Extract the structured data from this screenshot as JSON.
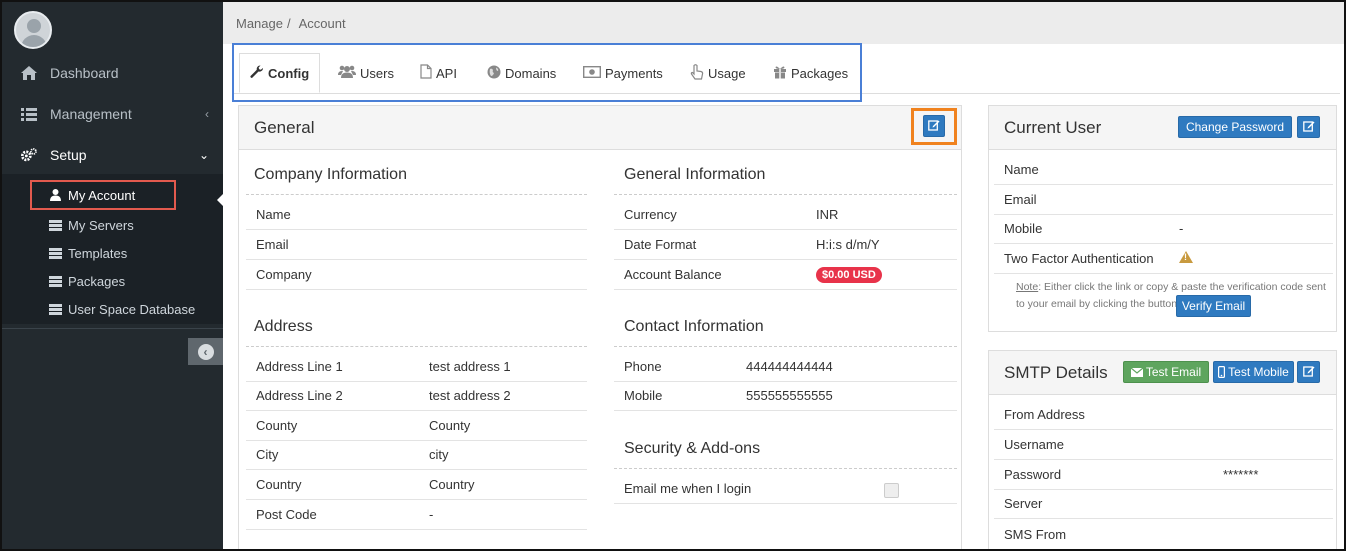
{
  "sidebar": {
    "nav": [
      {
        "label": "Dashboard",
        "icon": "home-icon"
      },
      {
        "label": "Management",
        "icon": "list-icon",
        "arrow": "‹"
      },
      {
        "label": "Setup",
        "icon": "cogs-icon",
        "arrow": "⌄"
      }
    ],
    "submenu": [
      {
        "label": "My Account",
        "icon": "user-icon"
      },
      {
        "label": "My Servers",
        "icon": "server-icon"
      },
      {
        "label": "Templates",
        "icon": "server-icon"
      },
      {
        "label": "Packages",
        "icon": "server-icon"
      },
      {
        "label": "User Space Database",
        "icon": "server-icon"
      }
    ]
  },
  "breadcrumb": {
    "part1": "Manage",
    "separator": "/",
    "part2": "Account"
  },
  "tabs": [
    {
      "label": "Config",
      "icon": "wrench-icon"
    },
    {
      "label": "Users",
      "icon": "users-icon"
    },
    {
      "label": "API",
      "icon": "file-icon"
    },
    {
      "label": "Domains",
      "icon": "globe-icon"
    },
    {
      "label": "Payments",
      "icon": "money-icon"
    },
    {
      "label": "Usage",
      "icon": "pointer-icon"
    },
    {
      "label": "Packages",
      "icon": "gift-icon"
    }
  ],
  "general": {
    "title": "General",
    "company": {
      "title": "Company Information",
      "rows": [
        {
          "label": "Name",
          "value": ""
        },
        {
          "label": "Email",
          "value": ""
        },
        {
          "label": "Company",
          "value": ""
        }
      ]
    },
    "address": {
      "title": "Address",
      "rows": [
        {
          "label": "Address Line 1",
          "value": "test address 1"
        },
        {
          "label": "Address Line 2",
          "value": "test address 2"
        },
        {
          "label": "County",
          "value": "County"
        },
        {
          "label": "City",
          "value": "city"
        },
        {
          "label": "Country",
          "value": "Country"
        },
        {
          "label": "Post Code",
          "value": "-"
        }
      ]
    },
    "general_info": {
      "title": "General Information",
      "rows": [
        {
          "label": "Currency",
          "value": "INR"
        },
        {
          "label": "Date Format",
          "value": "H:i:s d/m/Y"
        },
        {
          "label": "Account Balance",
          "value": "$0.00 USD"
        }
      ]
    },
    "contact": {
      "title": "Contact Information",
      "rows": [
        {
          "label": "Phone",
          "value": "444444444444"
        },
        {
          "label": "Mobile",
          "value": "555555555555"
        }
      ]
    },
    "security": {
      "title": "Security & Add-ons",
      "rows": [
        {
          "label": "Email me when I login"
        }
      ]
    }
  },
  "current_user": {
    "title": "Current User",
    "change_password": "Change Password",
    "rows": [
      {
        "label": "Name",
        "value": ""
      },
      {
        "label": "Email",
        "value": ""
      },
      {
        "label": "Mobile",
        "value": "-"
      },
      {
        "label": "Two Factor Authentication",
        "value": ""
      }
    ],
    "note_label": "Note",
    "note_text": ": Either click the link or copy & paste the verification code sent to your email by clicking the button.",
    "verify_button": "Verify Email"
  },
  "smtp": {
    "title": "SMTP Details",
    "test_email": "Test Email",
    "test_mobile": "Test Mobile",
    "rows": [
      {
        "label": "From Address",
        "value": ""
      },
      {
        "label": "Username",
        "value": ""
      },
      {
        "label": "Password",
        "value": "*******"
      },
      {
        "label": "Server",
        "value": ""
      },
      {
        "label": "SMS From",
        "value": ""
      }
    ]
  },
  "colors": {
    "sidebar": "#232a2f",
    "primary": "#2f7ac0",
    "success": "#5ea55e",
    "danger": "#e8334a",
    "highlight_red": "#e35a4e",
    "highlight_blue": "#4a7fd6",
    "highlight_orange": "#f0821e"
  }
}
